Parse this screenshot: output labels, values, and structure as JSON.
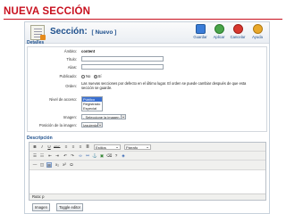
{
  "slide": {
    "title": "NUEVA SECCIÓN"
  },
  "header": {
    "title": "Sección:",
    "tag": "[ Nuevo ]"
  },
  "toolbar": {
    "buttons": [
      {
        "label": "Guardar",
        "icon": "save-icon"
      },
      {
        "label": "Aplicar",
        "icon": "apply-icon"
      },
      {
        "label": "Cancelar",
        "icon": "cancel-icon"
      },
      {
        "label": "Ayuda",
        "icon": "help-icon"
      }
    ]
  },
  "details": {
    "legend": "Detalles",
    "fields": {
      "scope_label": "Ámbito:",
      "scope_value": "content",
      "title_label": "Título:",
      "title_value": "",
      "alias_label": "Alias:",
      "alias_value": "",
      "published_label": "Publicado:",
      "published_no": "No",
      "published_yes": "Sí",
      "order_label": "Orden:",
      "order_text": "Las nuevas secciones por defecto en el último lugar. El orden se puede cambiar después de que esta sección se guarde.",
      "access_label": "Nivel de acceso:",
      "access_options": [
        "Público",
        "Registrado",
        "Especial"
      ],
      "access_selected": "Público",
      "image_label": "Imagen:",
      "image_value": "- Seleccione la imagen -",
      "image_pos_label": "Posición de la imagen:",
      "image_pos_value": "Izquierda"
    }
  },
  "description": {
    "legend": "Descripción",
    "style_select": "Estilos",
    "format_select": "Párrafo",
    "path": "Ruta: p"
  },
  "bottom": {
    "image_button": "Imagen",
    "toggle_button": "Toggle editor"
  }
}
